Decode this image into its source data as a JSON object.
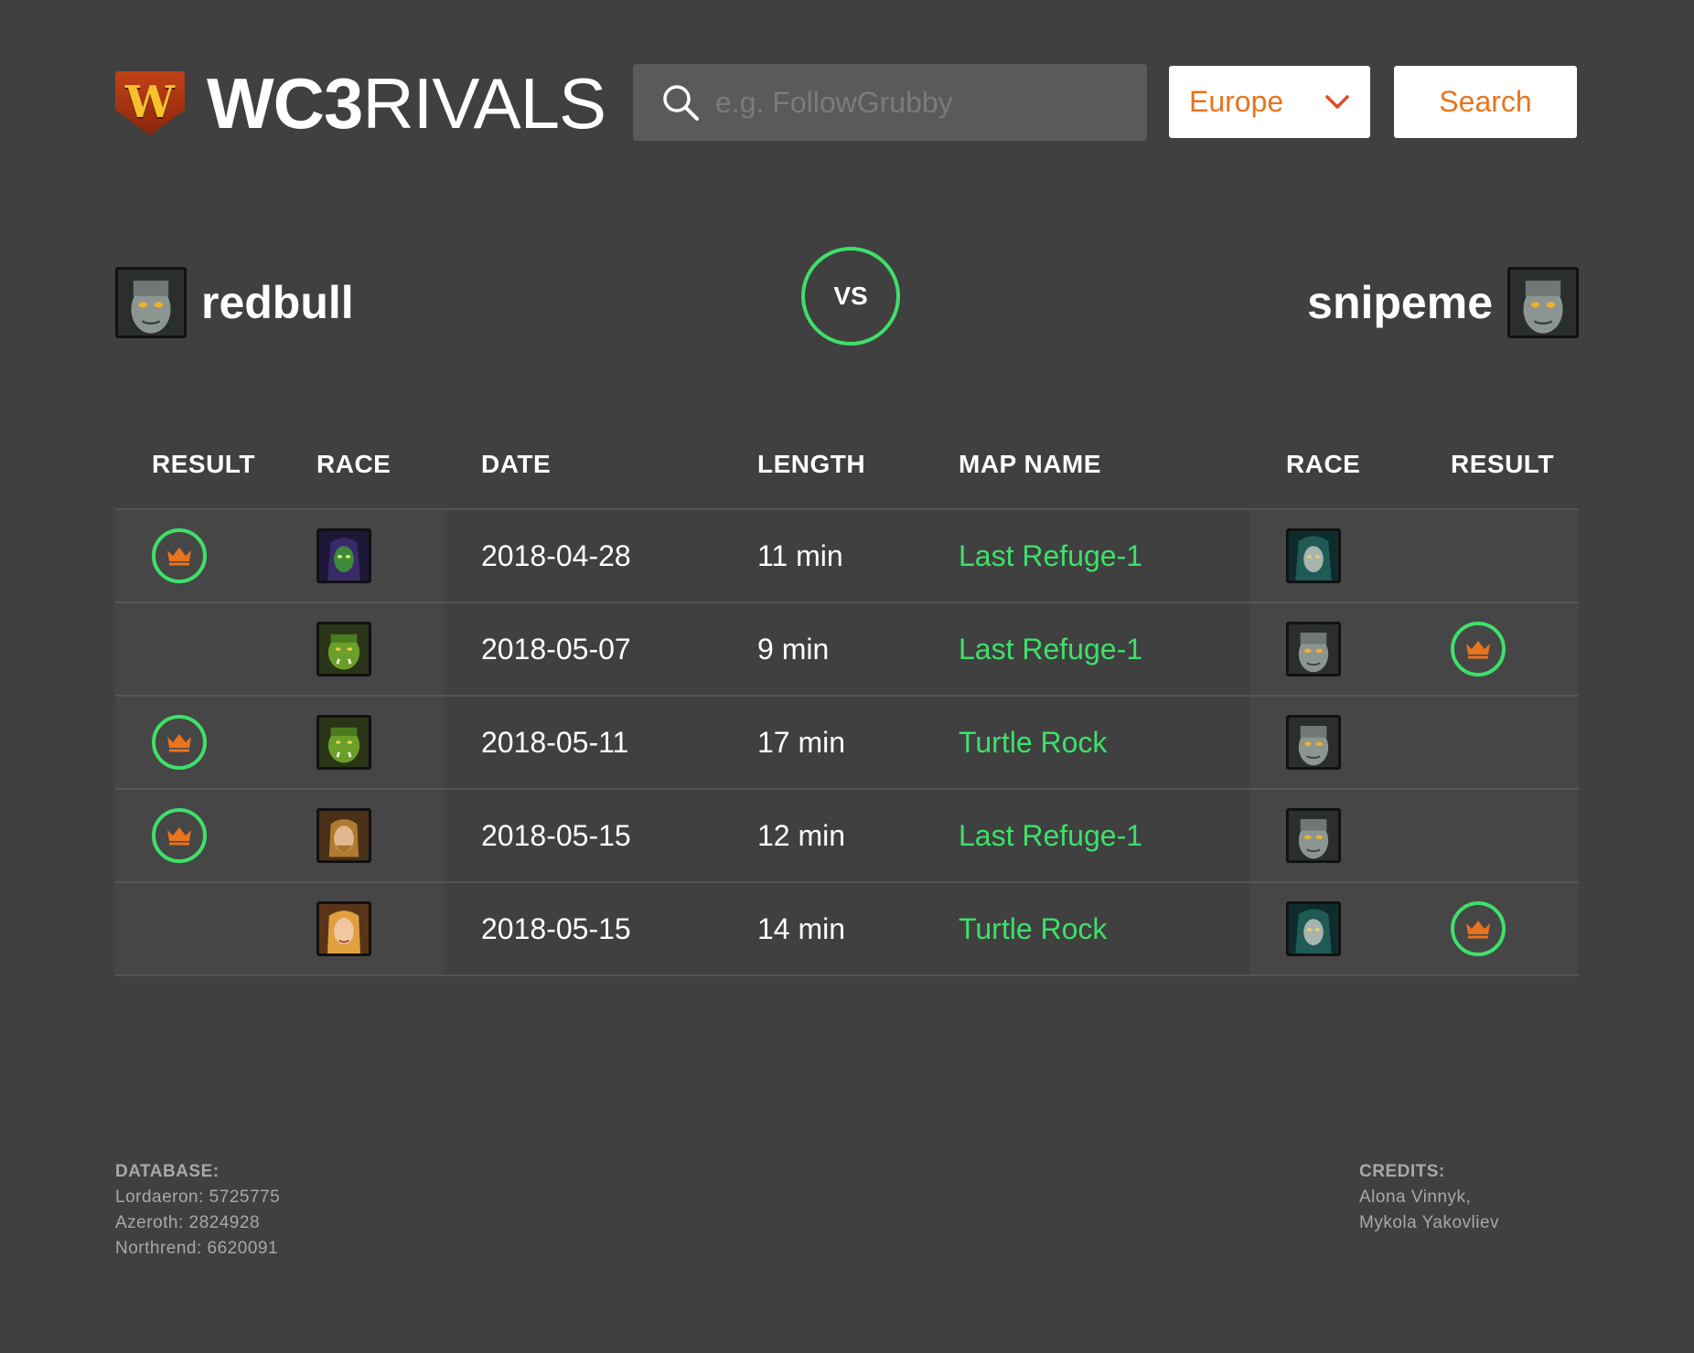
{
  "brand": {
    "bold": "WC3",
    "thin": "RIVALS",
    "badge_letter": "W"
  },
  "search": {
    "placeholder": "e.g. FollowGrubby",
    "value": ""
  },
  "region": {
    "selected": "Europe"
  },
  "search_button": "Search",
  "vs_label": "VS",
  "player_left": {
    "name": "redbull",
    "race": "undead"
  },
  "player_right": {
    "name": "snipeme",
    "race": "undead"
  },
  "columns": [
    "RESULT",
    "RACE",
    "DATE",
    "LENGTH",
    "MAP NAME",
    "RACE",
    "RESULT"
  ],
  "matches": [
    {
      "left_win": true,
      "left_race": "night-elf-warden",
      "date": "2018-04-28",
      "length": "11 min",
      "map": "Last Refuge-1",
      "right_race": "banshee",
      "right_win": false
    },
    {
      "left_win": false,
      "left_race": "orc",
      "date": "2018-05-07",
      "length": "9 min",
      "map": "Last Refuge-1",
      "right_race": "undead",
      "right_win": true
    },
    {
      "left_win": true,
      "left_race": "orc",
      "date": "2018-05-11",
      "length": "17 min",
      "map": "Turtle Rock",
      "right_race": "undead",
      "right_win": false
    },
    {
      "left_win": true,
      "left_race": "human-male",
      "date": "2018-05-15",
      "length": "12 min",
      "map": "Last Refuge-1",
      "right_race": "undead",
      "right_win": false
    },
    {
      "left_win": false,
      "left_race": "human-female",
      "date": "2018-05-15",
      "length": "14 min",
      "map": "Turtle Rock",
      "right_race": "banshee",
      "right_win": true
    }
  ],
  "footer": {
    "database_title": "DATABASE:",
    "database_lines": [
      "Lordaeron: 5725775",
      "Azeroth: 2824928",
      "Northrend: 6620091"
    ],
    "credits_title": "CREDITS:",
    "credits_lines": [
      "Alona Vinnyk,",
      "Mykola Yakovliev"
    ]
  },
  "colors": {
    "background": "#404040",
    "accent_green": "#3ee06a",
    "accent_orange": "#e8741d",
    "input_bg": "#5a5a5a"
  }
}
